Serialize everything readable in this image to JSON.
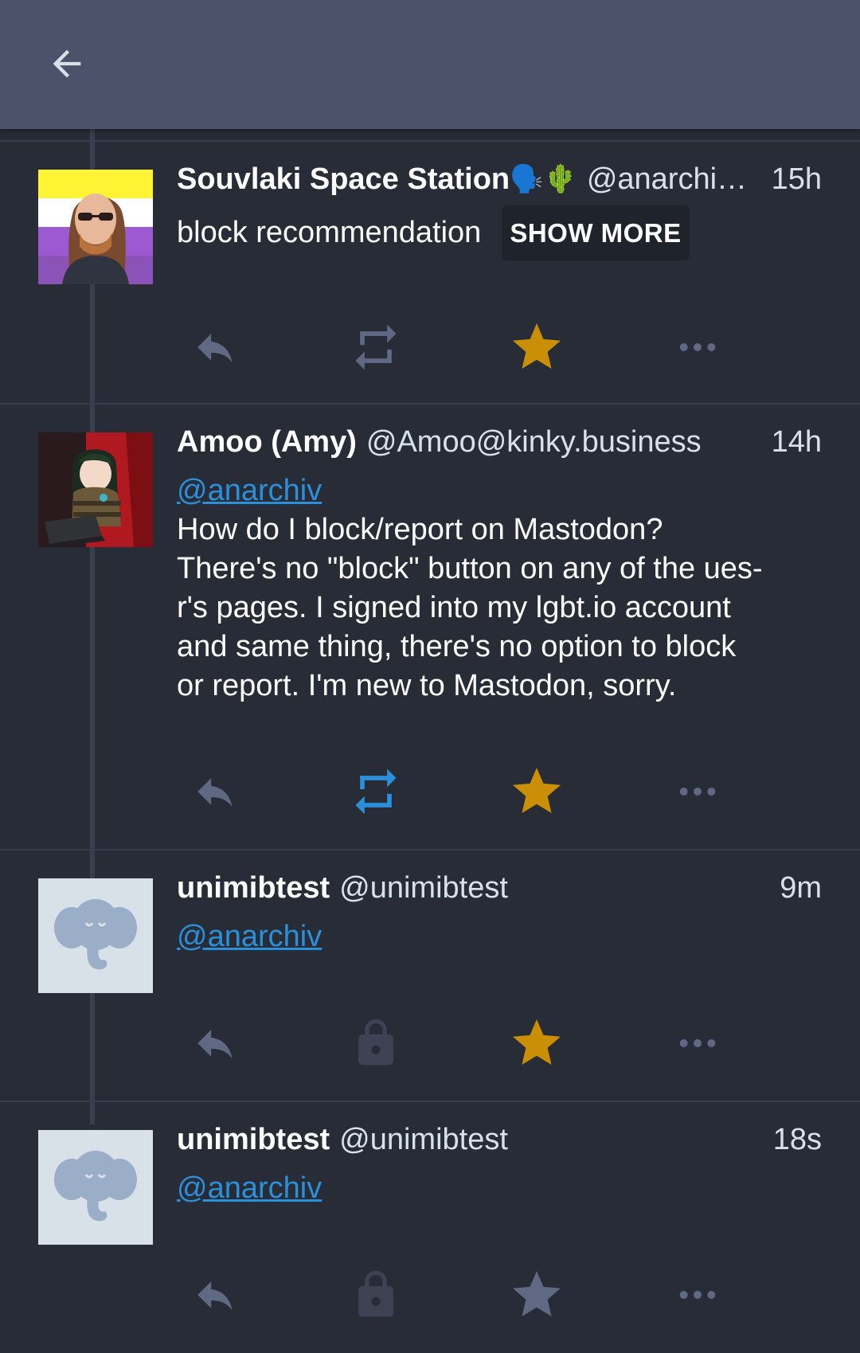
{
  "colors": {
    "appbar": "#4c526a",
    "background": "#282c37",
    "icon_muted": "#606984",
    "boost_active": "#2b90d9",
    "favourite_active": "#ca8f04",
    "mention_link": "#2b90d9",
    "show_more_bg": "#1f232b"
  },
  "appbar": {
    "back_icon": "arrow-left-icon"
  },
  "statuses": [
    {
      "display_name": "Souvlaki Space Station",
      "name_emoji": "🗣️🌵",
      "handle": "@anarchi…",
      "time": "15h",
      "content_warning": "block recommendation",
      "show_more_label": "SHOW MORE",
      "avatar": "user-photo-avatar",
      "boosted": false,
      "favourited": true,
      "boost_icon": "repeat-icon"
    },
    {
      "display_name": "Amoo (Amy)",
      "handle": "@Amoo@kinky.business",
      "time": "14h",
      "mention": "@anarchiv",
      "body_lines": [
        "How do I block/report on Mastodon?",
        "There's no \"block\" button on any of the ues-",
        "r's pages. I signed into my lgbt.io account",
        "and same thing, there's no option to block",
        "or report. I'm new to Mastodon, sorry."
      ],
      "avatar": "anime-girl-avatar",
      "boosted": true,
      "favourited": true,
      "boost_icon": "repeat-icon"
    },
    {
      "display_name": "unimibtest",
      "handle": "@unimibtest",
      "time": "9m",
      "mention": "@anarchiv",
      "avatar": "default-elephant-avatar",
      "boosted": false,
      "favourited": true,
      "boost_icon": "lock-icon"
    },
    {
      "display_name": "unimibtest",
      "handle": "@unimibtest",
      "time": "18s",
      "mention": "@anarchiv",
      "avatar": "default-elephant-avatar",
      "boosted": false,
      "favourited": false,
      "boost_icon": "lock-icon"
    }
  ]
}
